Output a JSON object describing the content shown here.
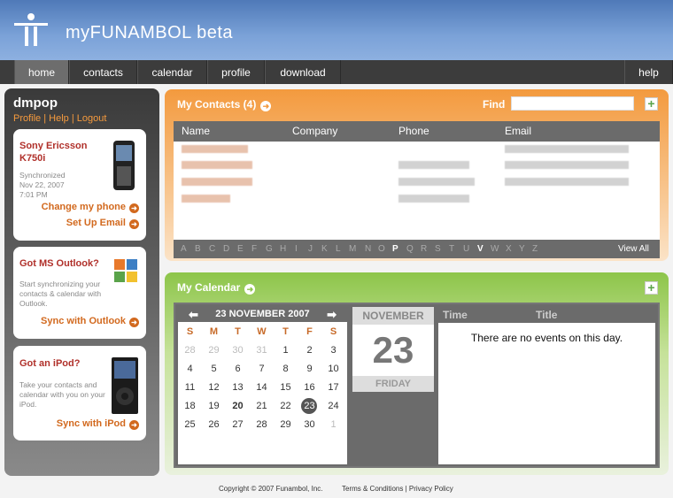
{
  "header": {
    "logo_text_light": "my",
    "logo_text_bold": "FUNAMBOL",
    "logo_text_suffix": " beta"
  },
  "nav": {
    "items": [
      "home",
      "contacts",
      "calendar",
      "profile",
      "download"
    ],
    "active": "home",
    "help": "help"
  },
  "sidebar": {
    "username": "dmpop",
    "links": [
      "Profile",
      "Help",
      "Logout"
    ],
    "phone_card": {
      "title": "Sony Ericsson K750i",
      "status": "Synchronized",
      "date": "Nov 22, 2007",
      "time": "7:01 PM",
      "link1": "Change my phone",
      "link2": "Set Up Email"
    },
    "outlook_card": {
      "title": "Got MS Outlook?",
      "text": "Start synchronizing your contacts & calendar with Outlook.",
      "link": "Sync with Outlook"
    },
    "ipod_card": {
      "title": "Got an iPod?",
      "text": "Take your contacts and calendar with you on your iPod.",
      "link": "Sync with iPod"
    }
  },
  "contacts": {
    "title": "My Contacts (4)",
    "find_label": "Find",
    "find_value": "",
    "columns": [
      "Name",
      "Company",
      "Phone",
      "Email"
    ],
    "alphabet": [
      "A",
      "B",
      "C",
      "D",
      "E",
      "F",
      "G",
      "H",
      "I",
      "J",
      "K",
      "L",
      "M",
      "N",
      "O",
      "P",
      "Q",
      "R",
      "S",
      "T",
      "U",
      "V",
      "W",
      "X",
      "Y",
      "Z"
    ],
    "alphabet_active": [
      "P",
      "V"
    ],
    "view_all": "View All"
  },
  "calendar": {
    "title": "My Calendar",
    "month_label": "23 NOVEMBER 2007",
    "weekdays": [
      "S",
      "M",
      "T",
      "W",
      "T",
      "F",
      "S"
    ],
    "weeks": [
      [
        "28",
        "29",
        "30",
        "31",
        "1",
        "2",
        "3"
      ],
      [
        "4",
        "5",
        "6",
        "7",
        "8",
        "9",
        "10"
      ],
      [
        "11",
        "12",
        "13",
        "14",
        "15",
        "16",
        "17"
      ],
      [
        "18",
        "19",
        "20",
        "21",
        "22",
        "23",
        "24"
      ],
      [
        "25",
        "26",
        "27",
        "28",
        "29",
        "30",
        "1"
      ]
    ],
    "selected_month": "NOVEMBER",
    "selected_day": "23",
    "selected_weekday": "FRIDAY",
    "events_columns": [
      "Time",
      "Title"
    ],
    "no_events": "There are no events on this day."
  },
  "footer": {
    "copyright": "Copyright © 2007 Funambol, Inc.",
    "terms": "Terms & Conditions",
    "sep": "|",
    "privacy": "Privacy Policy"
  }
}
